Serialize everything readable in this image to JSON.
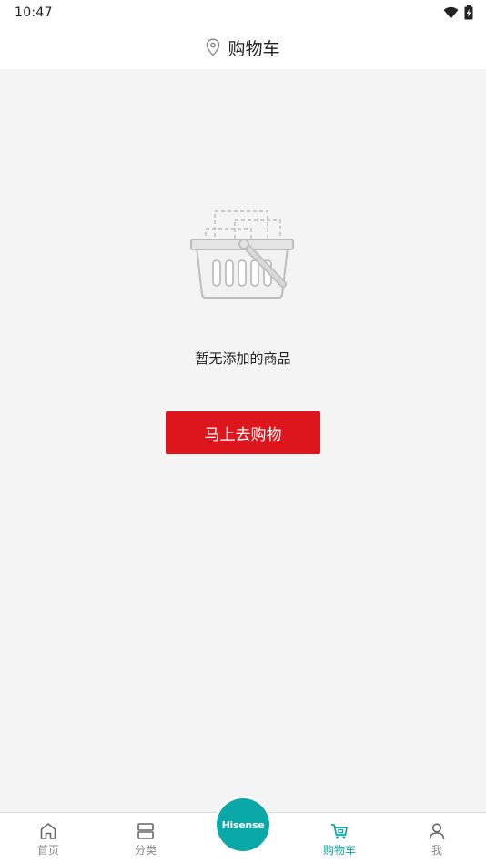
{
  "status_bar": {
    "time": "10:47",
    "wifi_icon": "wifi-icon",
    "battery_icon": "battery-charging-icon"
  },
  "header": {
    "location_icon": "location-pin-icon",
    "title": "购物车"
  },
  "empty_state": {
    "illustration_icon": "empty-basket-icon",
    "message": "暂无添加的商品",
    "button_label": "马上去购物"
  },
  "tab_bar": {
    "items": [
      {
        "label": "首页",
        "icon": "home-icon",
        "active": false
      },
      {
        "label": "分类",
        "icon": "category-icon",
        "active": false
      },
      {
        "label": "购物车",
        "icon": "cart-icon",
        "active": true
      },
      {
        "label": "我",
        "icon": "user-icon",
        "active": false
      }
    ],
    "brand_logo_text": "Hisense"
  },
  "colors": {
    "accent": "#0aa8a8",
    "button": "#dd161e",
    "background": "#f4f4f4"
  }
}
